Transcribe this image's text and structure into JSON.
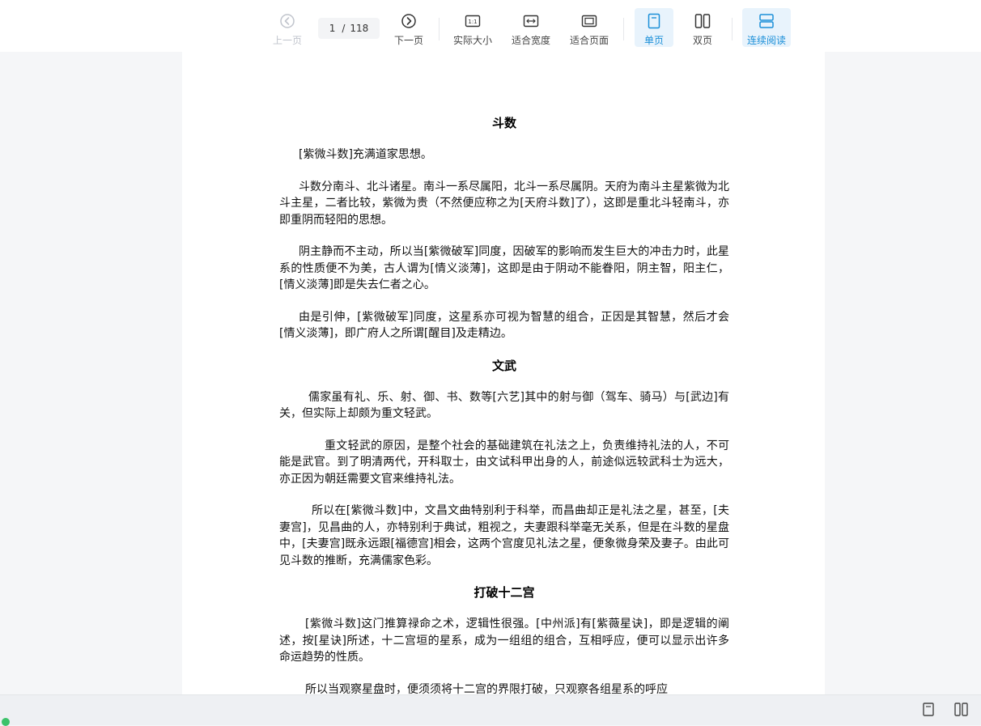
{
  "toolbar": {
    "prev_label": "上一页",
    "next_label": "下一页",
    "current_page": "1",
    "page_sep": "/",
    "total_pages": "118",
    "actual_size_label": "实际大小",
    "fit_width_label": "适合宽度",
    "fit_page_label": "适合页面",
    "single_page_label": "单页",
    "double_page_label": "双页",
    "continuous_label": "连续阅读",
    "actual_size_icon_text": "1:1"
  },
  "colors": {
    "accent": "#1a8fd8",
    "active_bg": "#e8f3fc",
    "disabled": "#c0c4cc",
    "status": "#3cc26a"
  },
  "icons": {
    "prev": "chevron-left-circle-icon",
    "next": "chevron-right-circle-icon",
    "actual_size": "one-to-one-icon",
    "fit_width": "fit-width-icon",
    "fit_page": "fit-page-icon",
    "single_page": "single-page-icon",
    "double_page": "double-page-icon",
    "continuous": "continuous-read-icon"
  },
  "document": {
    "sections": [
      {
        "title": "斗数",
        "paragraphs": [
          "[紫微斗数]充满道家思想。",
          "斗数分南斗、北斗诸星。南斗一系尽属阳，北斗一系尽属阴。天府为南斗主星紫微为北斗主星，二者比较，紫微为贵（不然便应称之为[天府斗数]了），这即是重北斗轻南斗，亦即重阴而轻阳的思想。",
          "阴主静而不主动，所以当[紫微破军]同度，因破军的影响而发生巨大的冲击力时，此星系的性质便不为美，古人谓为[情义淡薄]，这即是由于阴动不能眷阳，阴主智，阳主仁，[情义淡薄]即是失去仁者之心。",
          "由是引伸，[紫微破军]同度，这星系亦可视为智慧的组合，正因是其智慧，然后才会 [情义淡薄]，即广府人之所谓[醒目]及走精边。"
        ]
      },
      {
        "title": "文武",
        "paragraphs": [
          "儒家虽有礼、乐、射、御、书、数等[六艺]其中的射与御（驾车、骑马）与[武边]有关，但实际上却颇为重文轻武。",
          "重文轻武的原因，是整个社会的基础建筑在礼法之上，负责维持礼法的人，不可能是武官。到了明清两代，开科取士，由文试科甲出身的人，前途似远较武科士为远大，亦正因为朝廷需要文官来维持礼法。",
          "所以在[紫微斗数]中，文昌文曲特别利于科举，而昌曲却正是礼法之星，甚至，[夫妻宫]，见昌曲的人，亦特别利于典试，粗视之，夫妻跟科举毫无关系，但是在斗数的星盘中，[夫妻宫]既永远跟[福德宫]相会，这两个宫度见礼法之星，便象微身荣及妻子。由此可见斗数的推断，充满儒家色彩。"
        ]
      },
      {
        "title": "打破十二宫",
        "paragraphs": [
          "[紫微斗数]这门推算禄命之术，逻辑性很强。[中州派]有[紫薇星诀]，即是逻辑的阐述，按[星诀]所述，十二宫垣的星系，成为一组组的组合，互相呼应，便可以显示出许多命运趋势的性质。",
          "所以当观察星盘时，便须须将十二宫的界限打破，只观察各组星系的呼应"
        ]
      }
    ]
  }
}
